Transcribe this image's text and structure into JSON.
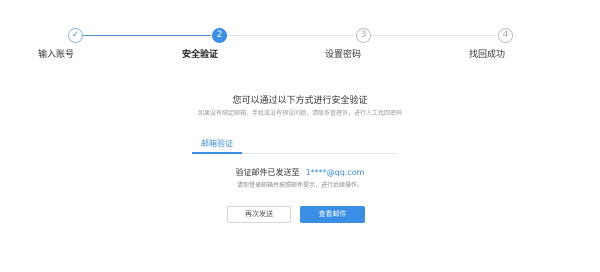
{
  "stepper": {
    "steps": [
      {
        "number": "✓",
        "label": "输入账号",
        "state": "done"
      },
      {
        "number": "2",
        "label": "安全验证",
        "state": "active"
      },
      {
        "number": "3",
        "label": "设置密码",
        "state": "todo"
      },
      {
        "number": "4",
        "label": "找回成功",
        "state": "todo"
      }
    ]
  },
  "content": {
    "heading": "您可以通过以下方式进行安全验证",
    "subheading": "如果没有绑定邮箱、手机或没有预设问题，请联系管理员，进行人工找回密码"
  },
  "tabs": [
    {
      "label": "邮箱验证",
      "active": true
    }
  ],
  "verification": {
    "sent_text": "验证邮件已发送至",
    "email": "1****@qq.com",
    "hint": "请你登录邮箱并按照邮件提示，进行后续操作。"
  },
  "buttons": {
    "resend_label": "再次发送",
    "view_label": "查看邮件"
  },
  "colors": {
    "accent": "#3a8ee6",
    "line_done": "#4a90d9",
    "line_todo": "#e2e2e2"
  }
}
